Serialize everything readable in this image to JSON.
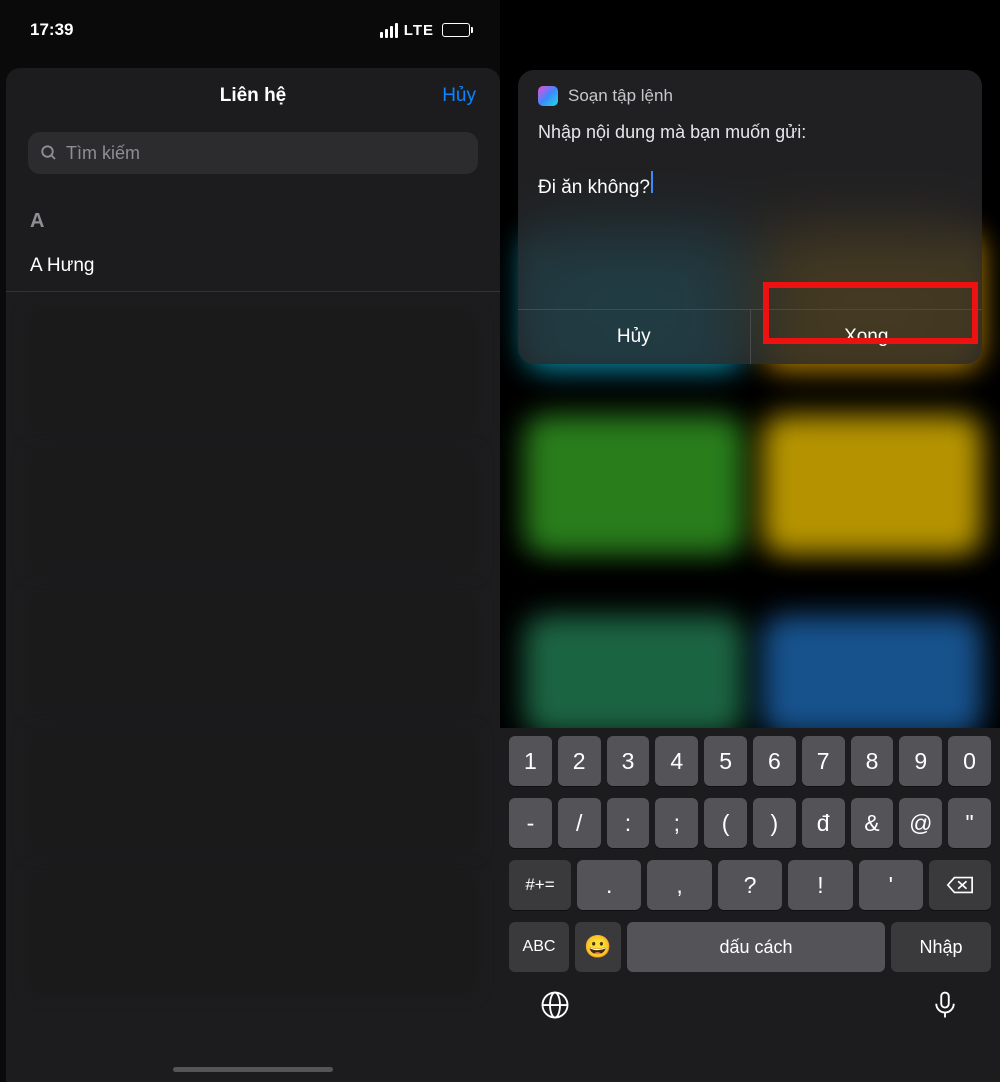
{
  "left": {
    "status_time": "17:39",
    "network_label": "LTE",
    "sheet": {
      "title": "Liên hệ",
      "cancel": "Hủy",
      "search_placeholder": "Tìm kiếm",
      "section_letter": "A",
      "contact_name": "A Hưng"
    }
  },
  "right": {
    "prompt": {
      "app_name": "Soạn tập lệnh",
      "label": "Nhập nội dung mà bạn muốn gửi:",
      "input_value": "Đi ăn không?",
      "cancel": "Hủy",
      "done": "Xong"
    },
    "keyboard": {
      "row1": [
        "1",
        "2",
        "3",
        "4",
        "5",
        "6",
        "7",
        "8",
        "9",
        "0"
      ],
      "row2": [
        "-",
        "/",
        ":",
        ";",
        "(",
        ")",
        "đ",
        "&",
        "@",
        "\""
      ],
      "row3_mode": "#+=",
      "row3": [
        ".",
        ",",
        "?",
        "!",
        "'"
      ],
      "abc": "ABC",
      "emoji": "😀",
      "space": "dấu cách",
      "return": "Nhập"
    }
  }
}
